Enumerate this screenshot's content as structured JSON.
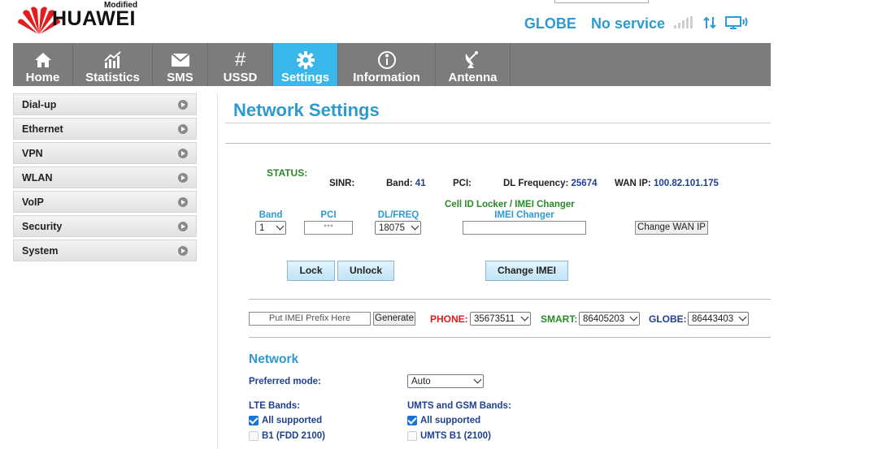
{
  "header": {
    "brand": "HUAWEI",
    "brand_tag": "Modified",
    "operator": "GLOBE",
    "service": "No service"
  },
  "nav": [
    {
      "label": "Home",
      "icon": "home-icon"
    },
    {
      "label": "Statistics",
      "icon": "statistics-icon"
    },
    {
      "label": "SMS",
      "icon": "envelope-icon"
    },
    {
      "label": "USSD",
      "icon": "hash-icon"
    },
    {
      "label": "Settings",
      "icon": "gear-icon"
    },
    {
      "label": "Information",
      "icon": "info-icon"
    },
    {
      "label": "Antenna",
      "icon": "satellite-dish-icon"
    }
  ],
  "sidebar": [
    {
      "label": "Dial-up"
    },
    {
      "label": "Ethernet"
    },
    {
      "label": "VPN"
    },
    {
      "label": "WLAN"
    },
    {
      "label": "VoIP"
    },
    {
      "label": "Security"
    },
    {
      "label": "System"
    }
  ],
  "page_title": "Network Settings",
  "status": {
    "label": "STATUS:",
    "sinr_label": "SINR:",
    "band_label": "Band:",
    "band_value": "41",
    "pci_label": "PCI:",
    "dl_freq_label": "DL Frequency:",
    "dl_freq_value": "25674",
    "wan_ip_label": "WAN IP:",
    "wan_ip_value": "100.82.101.175"
  },
  "locker": {
    "band_hdr": "Band",
    "pci_hdr": "PCI",
    "dlfreq_hdr": "DL/FREQ",
    "cellid_hdr": "Cell ID Locker / IMEI Changer",
    "imei_hdr": "IMEI Changer",
    "band_value": "1",
    "pci_placeholder": "***",
    "dlfreq_value": "18075",
    "change_wan_ip": "Change WAN IP",
    "lock": "Lock",
    "unlock": "Unlock",
    "change_imei": "Change IMEI"
  },
  "imei_row": {
    "prefix_placeholder": "Put IMEI Prefix Here",
    "generate": "Generate",
    "phone_label": "PHONE:",
    "phone_value": "35673511",
    "smart_label": "SMART:",
    "smart_value": "86405203",
    "globe_label": "GLOBE:",
    "globe_value": "86443403"
  },
  "network": {
    "title": "Network",
    "preferred_mode_label": "Preferred mode:",
    "preferred_mode_value": "Auto",
    "lte_bands_label": "LTE Bands:",
    "umts_bands_label": "UMTS and GSM Bands:",
    "lte_all": "All supported",
    "lte_b1": "B1 (FDD 2100)",
    "umts_all": "All supported",
    "umts_b1": "UMTS B1 (2100)"
  },
  "colors": {
    "accent": "#39b6ea",
    "title_blue": "#2e9ad0",
    "nav_bg": "#7c7c7c",
    "status_green": "#2a8a2a",
    "phone_red": "#d42020",
    "smart_green": "#2a8a2a",
    "globe_navy": "#1f3f8f"
  }
}
